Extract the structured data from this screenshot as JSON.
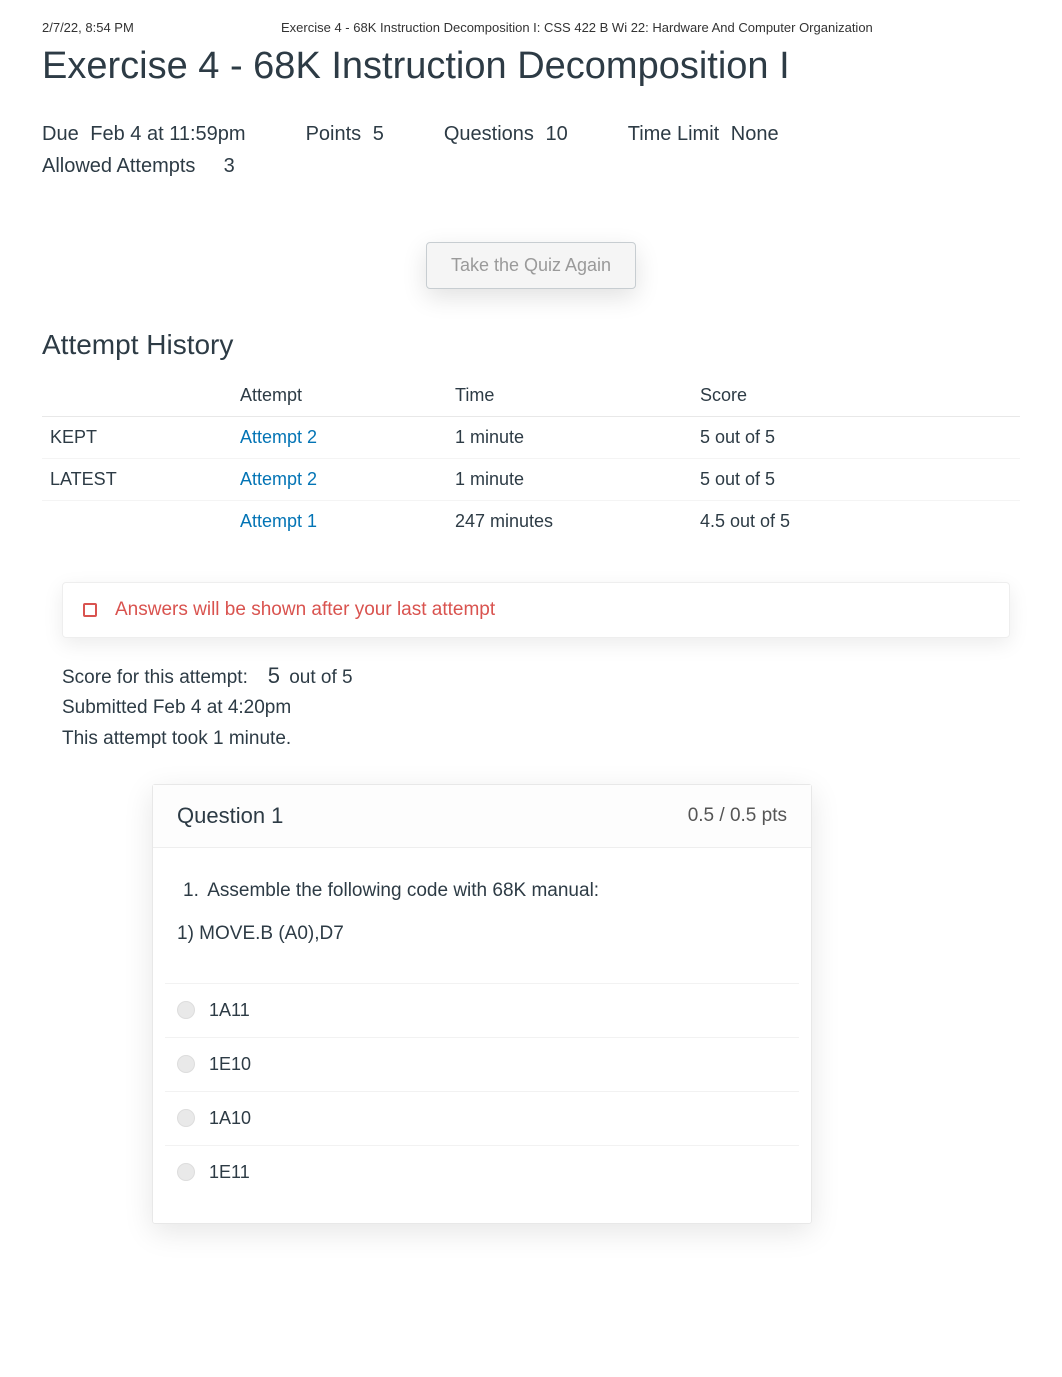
{
  "print_header": {
    "left": "2/7/22, 8:54 PM",
    "center": "Exercise 4 - 68K Instruction Decomposition I: CSS 422 B Wi 22: Hardware And Computer Organization"
  },
  "page_title": "Exercise 4 - 68K Instruction Decomposition I",
  "meta": {
    "due_label": "Due",
    "due_value": "Feb 4 at 11:59pm",
    "points_label": "Points",
    "points_value": "5",
    "questions_label": "Questions",
    "questions_value": "10",
    "time_limit_label": "Time Limit",
    "time_limit_value": "None",
    "allowed_label": "Allowed Attempts",
    "allowed_value": "3"
  },
  "take_again_button": "Take the Quiz Again",
  "history": {
    "title": "Attempt History",
    "headers": {
      "blank": "",
      "attempt": "Attempt",
      "time": "Time",
      "score": "Score"
    },
    "rows": [
      {
        "tag": "KEPT",
        "attempt": "Attempt 2",
        "time": "1 minute",
        "score": "5 out of 5"
      },
      {
        "tag": "LATEST",
        "attempt": "Attempt 2",
        "time": "1 minute",
        "score": "5 out of 5"
      },
      {
        "tag": "",
        "attempt": "Attempt 1",
        "time": "247 minutes",
        "score": "4.5 out of 5"
      }
    ]
  },
  "notice": "Answers will be shown after your last attempt",
  "score_info": {
    "score_prefix": "Score for this attempt:",
    "score_value": "5",
    "score_suffix": "out of 5",
    "submitted": "Submitted Feb 4 at 4:20pm",
    "duration": "This attempt took 1 minute."
  },
  "question": {
    "title": "Question 1",
    "points": "0.5 / 0.5 pts",
    "prompt_num": "1.",
    "prompt_text": "Assemble the following code with 68K manual:",
    "sub": "1) MOVE.B (A0),D7",
    "options": [
      "1A11",
      "1E10",
      "1A10",
      "1E11"
    ]
  }
}
